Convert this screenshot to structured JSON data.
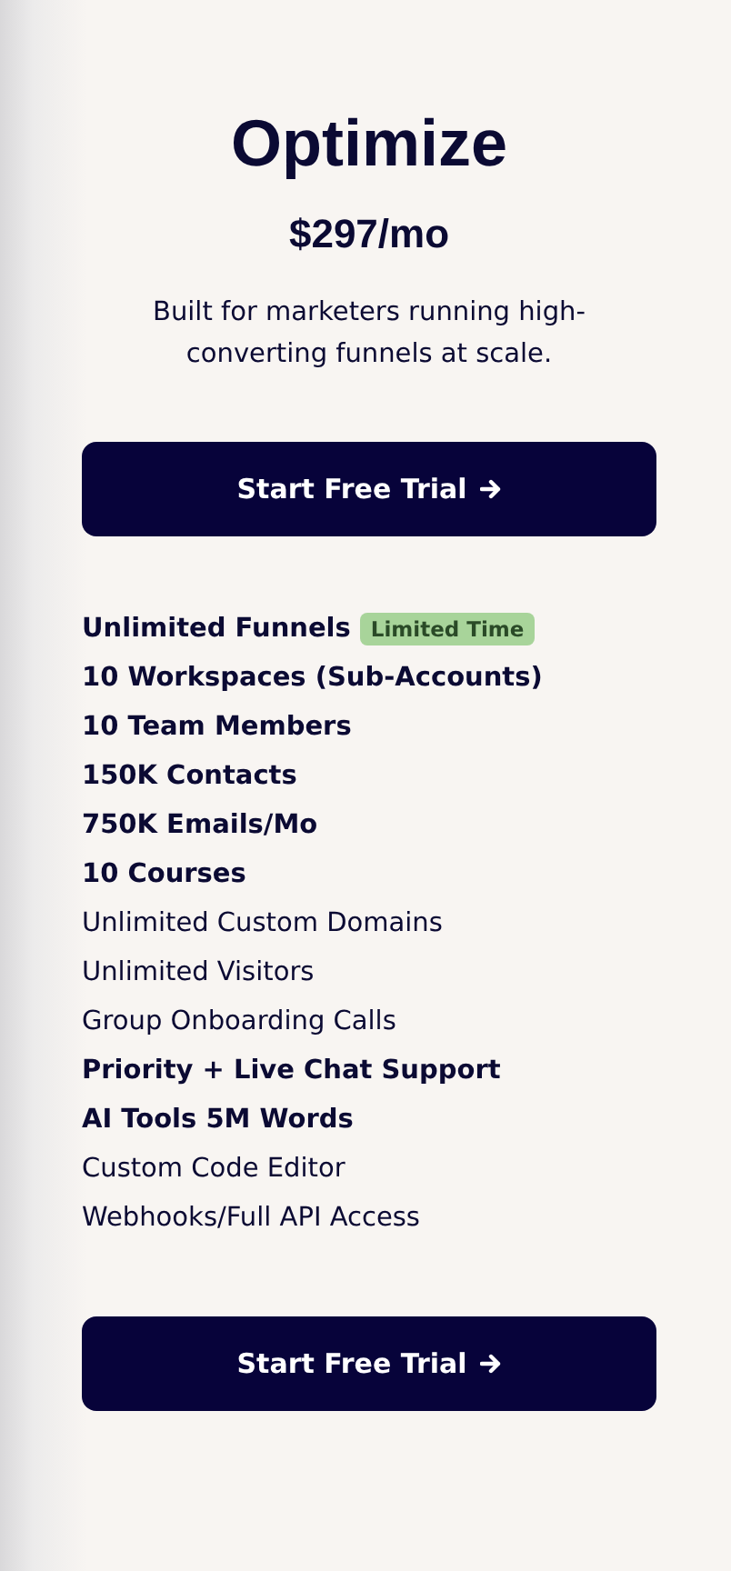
{
  "plan": {
    "name": "Optimize",
    "price": "$297/mo",
    "description": "Built for marketers running high-converting funnels at scale."
  },
  "top_button": {
    "label": "Start Free Trial"
  },
  "features": [
    {
      "text": "Unlimited Funnels",
      "bold": true,
      "badge": "Limited Time"
    },
    {
      "text": "10 Workspaces (Sub-Accounts)",
      "bold": true
    },
    {
      "text": "10 Team Members",
      "bold": true
    },
    {
      "text": "150K Contacts",
      "bold": true
    },
    {
      "text": "750K Emails/Mo",
      "bold": true
    },
    {
      "text": "10 Courses",
      "bold": true
    },
    {
      "text": "Unlimited Custom Domains",
      "bold": false
    },
    {
      "text": "Unlimited Visitors",
      "bold": false
    },
    {
      "text": "Group Onboarding Calls",
      "bold": false
    },
    {
      "text": "Priority + Live Chat Support",
      "bold": true
    },
    {
      "text": "AI Tools 5M Words",
      "bold": true
    },
    {
      "text": "Custom Code Editor",
      "bold": false
    },
    {
      "text": "Webhooks/Full API Access",
      "bold": false
    }
  ],
  "bottom_button": {
    "label": "Start Free Trial"
  }
}
